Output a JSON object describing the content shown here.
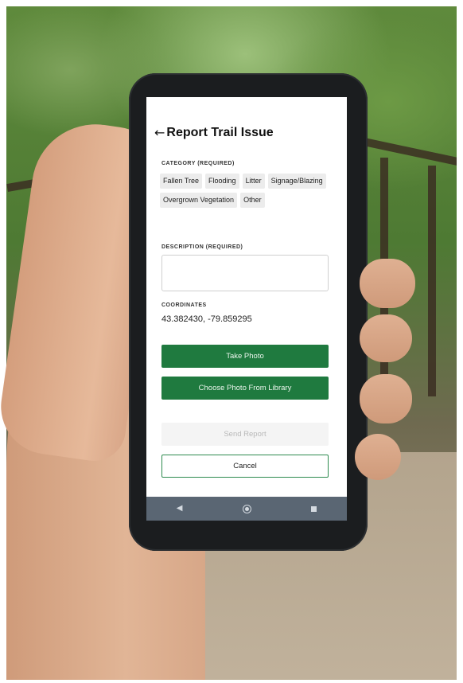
{
  "header": {
    "back_icon": "arrow-left-icon",
    "title": "Report Trail Issue"
  },
  "category": {
    "label": "CATEGORY (REQUIRED)",
    "options": [
      "Fallen Tree",
      "Flooding",
      "Litter",
      "Signage/Blazing",
      "Overgrown Vegetation",
      "Other"
    ]
  },
  "description": {
    "label": "DESCRIPTION (REQUIRED)",
    "value": "",
    "placeholder": ""
  },
  "coordinates": {
    "label": "COORDINATES",
    "value": "43.382430, -79.859295"
  },
  "buttons": {
    "take_photo": "Take Photo",
    "choose_photo": "Choose Photo From Library",
    "send_report": "Send Report",
    "cancel": "Cancel"
  },
  "navbar": {
    "back": "nav-back-icon",
    "home": "nav-home-icon",
    "recents": "nav-recents-icon"
  },
  "colors": {
    "primary_green": "#1f7a3f",
    "chip_bg": "#ececec",
    "navbar_bg": "#5a6673"
  }
}
